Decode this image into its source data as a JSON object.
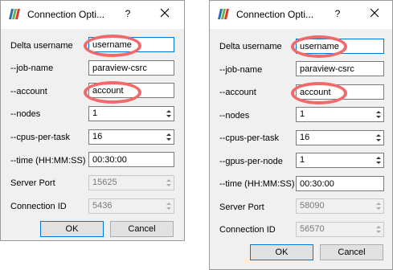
{
  "dialogs": [
    {
      "title": "Connection Opti...",
      "help": "?",
      "fields": [
        {
          "label": "Delta username",
          "value": "username"
        },
        {
          "label": "--job-name",
          "value": "paraview-csrc"
        },
        {
          "label": "--account",
          "value": "account"
        },
        {
          "label": "--nodes",
          "value": "1"
        },
        {
          "label": "--cpus-per-task",
          "value": "16"
        },
        {
          "label": "--time (HH:MM:SS)",
          "value": "00:30:00"
        },
        {
          "label": "Server Port",
          "value": "15625"
        },
        {
          "label": "Connection ID",
          "value": "5436"
        }
      ],
      "ok_label": "OK",
      "cancel_label": "Cancel"
    },
    {
      "title": "Connection Opti...",
      "help": "?",
      "fields": [
        {
          "label": "Delta username",
          "value": "username"
        },
        {
          "label": "--job-name",
          "value": "paraview-csrc"
        },
        {
          "label": "--account",
          "value": "account"
        },
        {
          "label": "--nodes",
          "value": "1"
        },
        {
          "label": "--cpus-per-task",
          "value": "16"
        },
        {
          "label": "--gpus-per-node",
          "value": "1"
        },
        {
          "label": "--time (HH:MM:SS)",
          "value": "00:30:00"
        },
        {
          "label": "Server Port",
          "value": "58090"
        },
        {
          "label": "Connection ID",
          "value": "56570"
        }
      ],
      "ok_label": "OK",
      "cancel_label": "Cancel"
    }
  ],
  "colors": {
    "highlight": "#ef6b6b",
    "focus_border": "#0078d7",
    "dialog_bg": "#f0f0f0"
  },
  "icons": {
    "app": "paraview-logo-icon",
    "close": "close-icon",
    "spin": "spin-arrows-icon"
  }
}
